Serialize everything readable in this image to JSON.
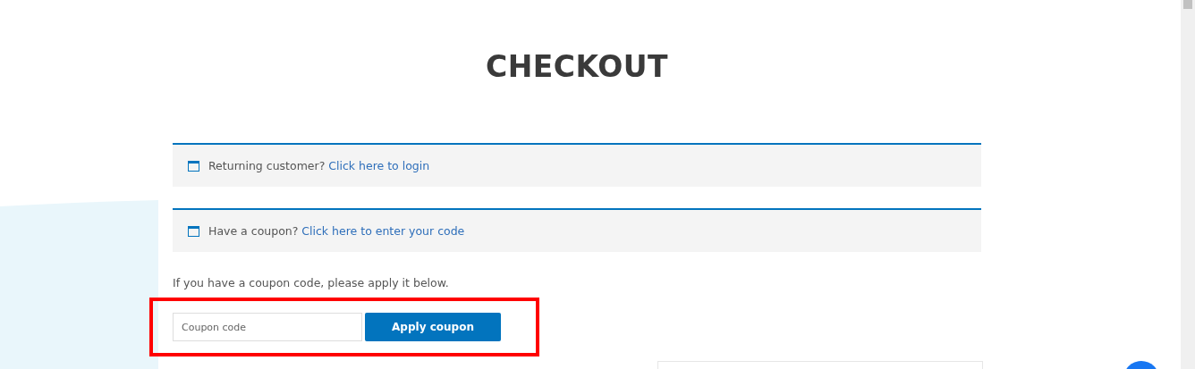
{
  "title": "CHECKOUT",
  "notices": [
    {
      "prompt": "Returning customer?",
      "link": "Click here to login"
    },
    {
      "prompt": "Have a coupon?",
      "link": "Click here to enter your code"
    }
  ],
  "coupon_hint": "If you have a coupon code, please apply it below.",
  "coupon_field": {
    "placeholder": "Coupon code"
  },
  "apply_button": "Apply coupon"
}
